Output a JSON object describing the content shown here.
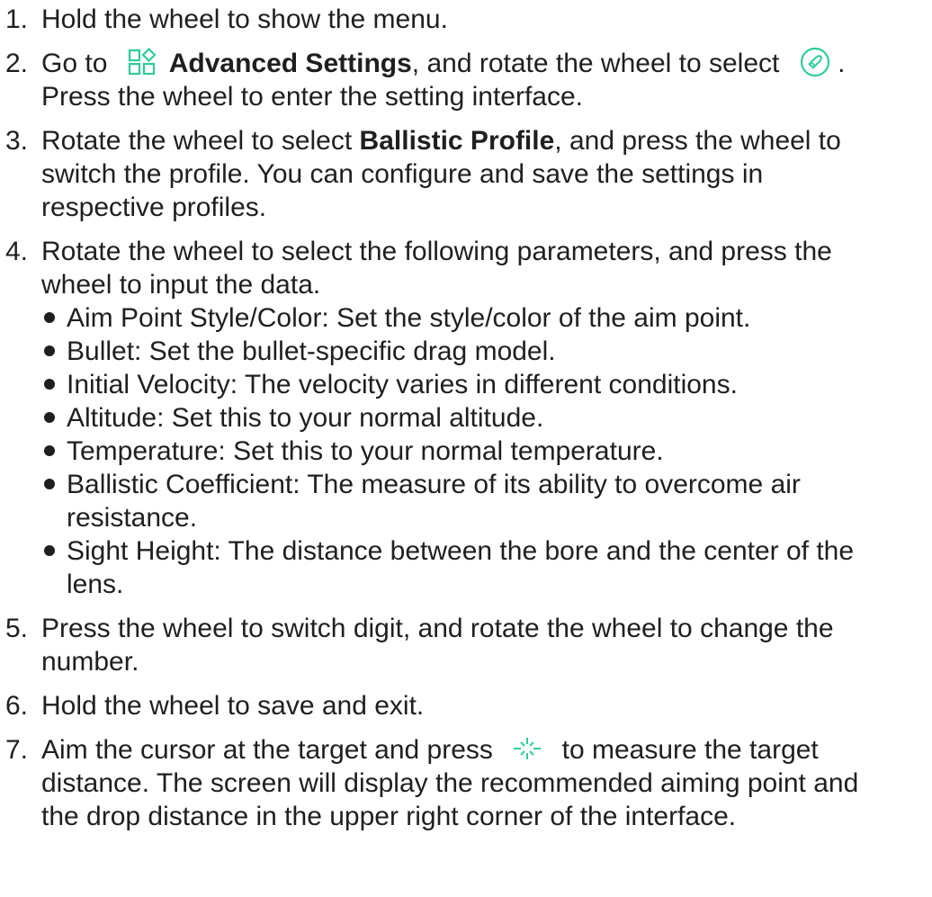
{
  "accent_color": "#2ecc9b",
  "steps": [
    {
      "num": "1.",
      "text": "Hold the wheel to show the menu."
    },
    {
      "num": "2.",
      "go_to": "Go to",
      "advanced_icon": "grid-diamond-icon",
      "advanced_label": "Advanced Settings",
      "after_advanced": ", and rotate the wheel to select",
      "ballistic_icon": "ballistic-icon",
      "period": ".",
      "line2": "Press the wheel to enter the setting interface."
    },
    {
      "num": "3.",
      "before_bold": "Rotate the wheel to select ",
      "bold": "Ballistic Profile",
      "after_bold": ", and press the wheel to",
      "line2": "switch the profile. You can configure and save the settings in",
      "line3": "respective profiles."
    },
    {
      "num": "4.",
      "line1": "Rotate the wheel to select the following parameters, and press the",
      "line2": "wheel to input the data.",
      "bullets": [
        {
          "lines": [
            "Aim Point Style/Color: Set the style/color of the aim point."
          ]
        },
        {
          "lines": [
            "Bullet: Set the bullet-specific drag model."
          ]
        },
        {
          "lines": [
            "Initial Velocity: The velocity varies in different conditions."
          ]
        },
        {
          "lines": [
            "Altitude: Set this to your normal altitude."
          ]
        },
        {
          "lines": [
            "Temperature: Set this to your normal temperature."
          ]
        },
        {
          "lines": [
            "Ballistic Coefficient: The measure of its ability to overcome air",
            "resistance."
          ]
        },
        {
          "lines": [
            "Sight Height: The distance between the bore and the center of the",
            "lens."
          ]
        }
      ]
    },
    {
      "num": "5.",
      "line1": "Press the wheel to switch digit, and rotate the wheel to change the",
      "line2": "number."
    },
    {
      "num": "6.",
      "text": "Hold the wheel to save and exit."
    },
    {
      "num": "7.",
      "before_icon": "Aim the cursor at the target and press",
      "laser_icon": "laser-range-icon",
      "after_icon": "to measure the target",
      "line2": "distance. The screen will display the recommended aiming point and",
      "line3": "the drop distance in the upper right corner of the interface."
    }
  ]
}
